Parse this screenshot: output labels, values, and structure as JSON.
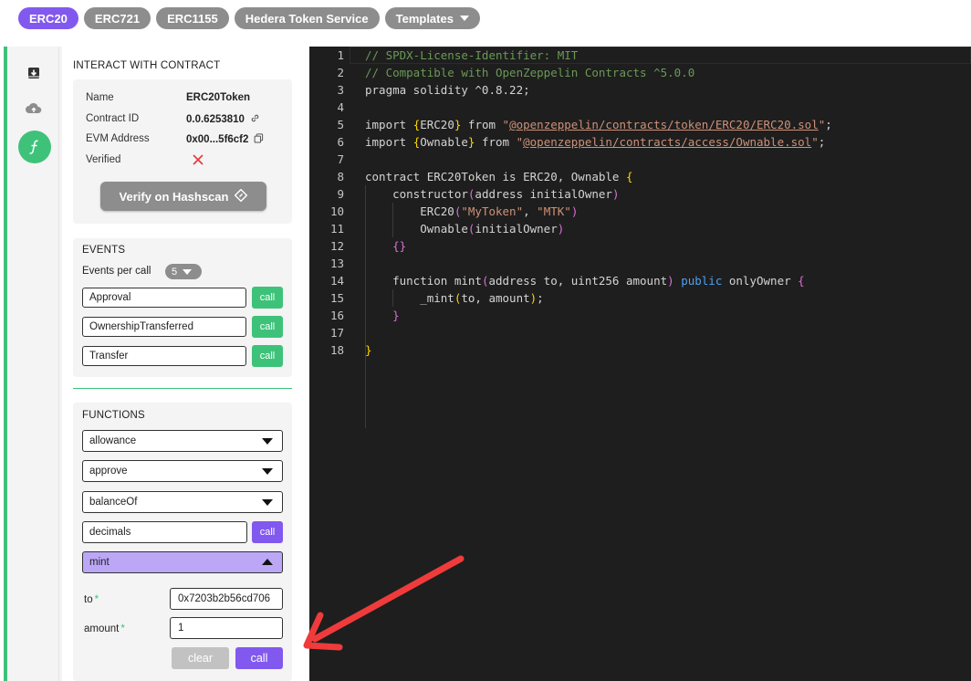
{
  "tabs": [
    {
      "label": "ERC20",
      "active": true
    },
    {
      "label": "ERC721",
      "active": false
    },
    {
      "label": "ERC1155",
      "active": false
    },
    {
      "label": "Hedera Token Service",
      "active": false
    },
    {
      "label": "Templates",
      "active": false,
      "dropdown": true
    }
  ],
  "rail": {
    "icons": [
      "download-icon",
      "cloud-upload-icon",
      "function-icon"
    ],
    "active_index": 2
  },
  "contract": {
    "title": "INTERACT WITH CONTRACT",
    "name_label": "Name",
    "name_value": "ERC20Token",
    "id_label": "Contract ID",
    "id_value": "0.0.6253810",
    "evm_label": "EVM Address",
    "evm_value": "0x00...5f6cf2",
    "verified_label": "Verified",
    "verified_value": false,
    "verify_button": "Verify on Hashscan"
  },
  "events": {
    "title": "EVENTS",
    "per_call_label": "Events per call",
    "per_call_value": "5",
    "call_label": "call",
    "items": [
      "Approval",
      "OwnershipTransferred",
      "Transfer"
    ]
  },
  "functions": {
    "title": "FUNCTIONS",
    "call_label": "call",
    "items": [
      {
        "name": "allowance",
        "kind": "select"
      },
      {
        "name": "approve",
        "kind": "select"
      },
      {
        "name": "balanceOf",
        "kind": "select"
      },
      {
        "name": "decimals",
        "kind": "call"
      },
      {
        "name": "mint",
        "kind": "select-open"
      }
    ],
    "mint_params": [
      {
        "label": "to",
        "required_mark": "*",
        "value": "0x7203b2b56cd706"
      },
      {
        "label": "amount",
        "required_mark": "*",
        "value": "1"
      }
    ],
    "clear_label": "clear",
    "submit_label": "call"
  },
  "editor": {
    "lines": [
      [
        [
          "// SPDX-License-Identifier: MIT",
          "com"
        ]
      ],
      [
        [
          "// Compatible with OpenZeppelin Contracts ^5.0.0",
          "com"
        ]
      ],
      [
        [
          "pragma solidity ^0.8.22;",
          ""
        ]
      ],
      [],
      [
        [
          "import ",
          ""
        ],
        [
          "{",
          "br1"
        ],
        [
          "ERC20",
          ""
        ],
        [
          "}",
          "br1"
        ],
        [
          " from ",
          ""
        ],
        [
          "\"",
          "str"
        ],
        [
          "@openzeppelin/contracts/token/ERC20/ERC20.sol",
          "strl"
        ],
        [
          "\"",
          "str"
        ],
        [
          ";",
          ""
        ]
      ],
      [
        [
          "import ",
          ""
        ],
        [
          "{",
          "br1"
        ],
        [
          "Ownable",
          ""
        ],
        [
          "}",
          "br1"
        ],
        [
          " from ",
          ""
        ],
        [
          "\"",
          "str"
        ],
        [
          "@openzeppelin/contracts/access/Ownable.sol",
          "strl"
        ],
        [
          "\"",
          "str"
        ],
        [
          ";",
          ""
        ]
      ],
      [],
      [
        [
          "contract ERC20Token is ERC20, Ownable ",
          ""
        ],
        [
          "{",
          "br1"
        ]
      ],
      [
        [
          "    constructor",
          ""
        ],
        [
          "(",
          "br2"
        ],
        [
          "address initialOwner",
          ""
        ],
        [
          ")",
          "br2"
        ]
      ],
      [
        [
          "        ERC20",
          ""
        ],
        [
          "(",
          "br2"
        ],
        [
          "\"MyToken\"",
          "str"
        ],
        [
          ", ",
          ""
        ],
        [
          "\"MTK\"",
          "str"
        ],
        [
          ")",
          "br2"
        ]
      ],
      [
        [
          "        Ownable",
          ""
        ],
        [
          "(",
          "br2"
        ],
        [
          "initialOwner",
          ""
        ],
        [
          ")",
          "br2"
        ]
      ],
      [
        [
          "    ",
          ""
        ],
        [
          "{}",
          "br2"
        ]
      ],
      [],
      [
        [
          "    function mint",
          ""
        ],
        [
          "(",
          "br2"
        ],
        [
          "address to, uint256 amount",
          ""
        ],
        [
          ")",
          "br2"
        ],
        [
          " ",
          ""
        ],
        [
          "public",
          "kw"
        ],
        [
          " onlyOwner ",
          ""
        ],
        [
          "{",
          "br2"
        ]
      ],
      [
        [
          "        _mint",
          ""
        ],
        [
          "(",
          "br1"
        ],
        [
          "to, amount",
          ""
        ],
        [
          ")",
          "br1"
        ],
        [
          ";",
          ""
        ]
      ],
      [
        [
          "    ",
          ""
        ],
        [
          "}",
          "br2"
        ]
      ],
      [],
      [
        [
          "}",
          "br1"
        ]
      ]
    ]
  }
}
